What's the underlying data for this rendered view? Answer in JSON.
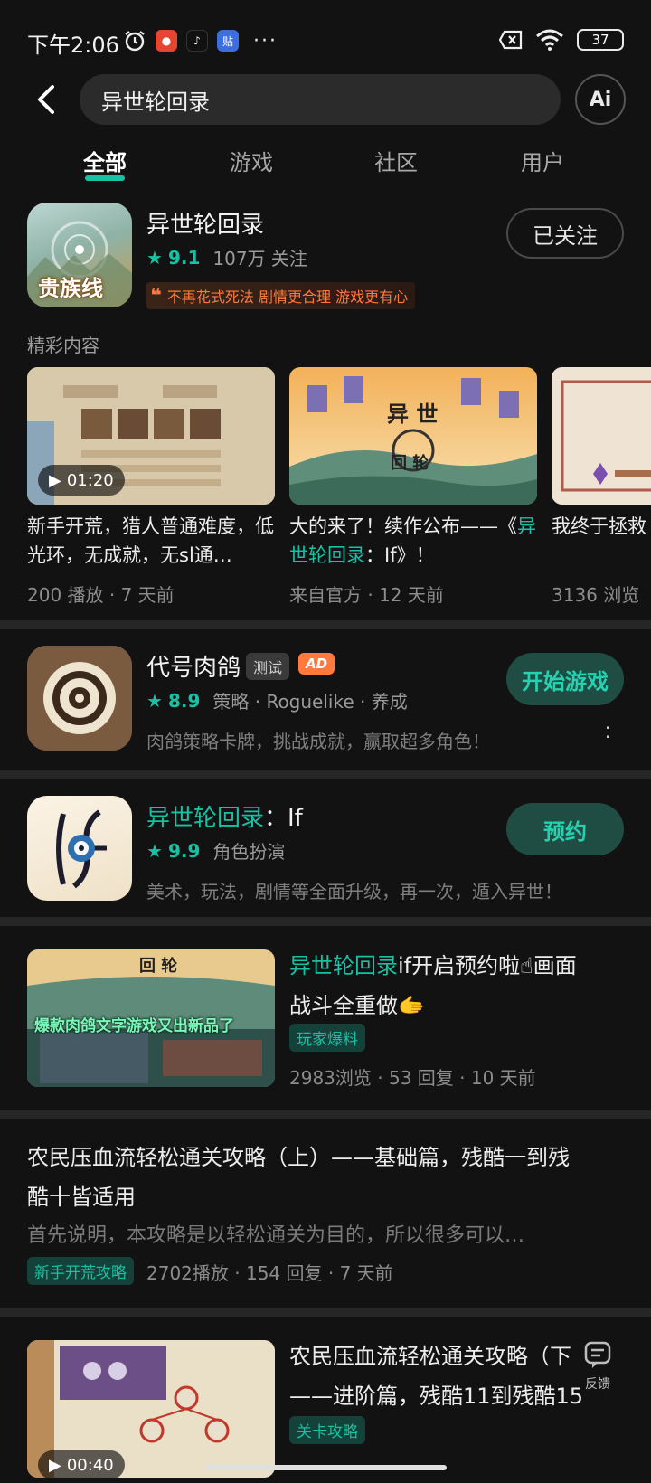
{
  "status": {
    "time": "下午2:06",
    "battery": "37",
    "apps": [
      "alarm-icon",
      "app-icon-red",
      "tiktok-icon",
      "tieba-icon",
      "more-dots-icon"
    ]
  },
  "search": {
    "query": "异世轮回录",
    "ai_label": "Ai"
  },
  "tabs": [
    {
      "label": "全部"
    },
    {
      "label": "游戏"
    },
    {
      "label": "社区"
    },
    {
      "label": "用户"
    }
  ],
  "main_game": {
    "title": "异世轮回录",
    "rating": "9.1",
    "followers": "107万 关注",
    "follow_button": "已关注",
    "icon_text": "贵族线",
    "tagline": "不再花式死法 剧情更合理 游戏更有心"
  },
  "highlights": {
    "label": "精彩内容",
    "items": [
      {
        "title": "新手开荒，猎人普通难度，低光环，无成就，无sl通…",
        "meta": "200 播放 · 7 天前",
        "duration": "01:20"
      },
      {
        "title_prefix": "大的来了！续作公布——《",
        "title_highlight": "异世轮回录",
        "title_suffix": "：If》！",
        "meta": "来自官方 · 12 天前"
      },
      {
        "title": "我终于拯救",
        "meta": "3136 浏览"
      }
    ]
  },
  "ad_game": {
    "title": "代号肉鸽",
    "badge_test": "测试",
    "badge_ad": "AD",
    "rating": "8.9",
    "tags": "策略 · Roguelike · 养成",
    "desc": "肉鸽策略卡牌，挑战成就，赢取超多角色！",
    "button": "开始游戏"
  },
  "if_game": {
    "title_highlight": "异世轮回录",
    "title_suffix": "：If",
    "rating": "9.9",
    "tags": "角色扮演",
    "desc": "美术，玩法，剧情等全面升级，再一次，遁入异世！",
    "button": "预约"
  },
  "post1": {
    "title_highlight": "异世轮回录",
    "title_line1_suffix": "if开启预约啦☝画面",
    "title_line2": "战斗全重做🫱",
    "badge": "玩家爆料",
    "meta": "2983浏览 · 53 回复 · 10 天前",
    "thumb_caption": "爆款肉鸽文字游戏又出新品了"
  },
  "post2": {
    "title_line1": "农民压血流轻松通关攻略（上）——基础篇，残酷一到残",
    "title_line2": "酷十皆适用",
    "excerpt": "首先说明，本攻略是以轻松通关为目的，所以很多可以…",
    "badge": "新手开荒攻略",
    "meta": "2702播放 · 154 回复 · 7 天前"
  },
  "post3": {
    "title_line1": "农民压血流轻松通关攻略（下",
    "title_line2": "——进阶篇，残酷11到残酷15",
    "badge": "关卡攻略",
    "duration": "00:40"
  },
  "feedback_label": "反馈",
  "colors": {
    "accent": "#16c2a3",
    "background": "#121212",
    "card_button": "#1f4d43"
  }
}
